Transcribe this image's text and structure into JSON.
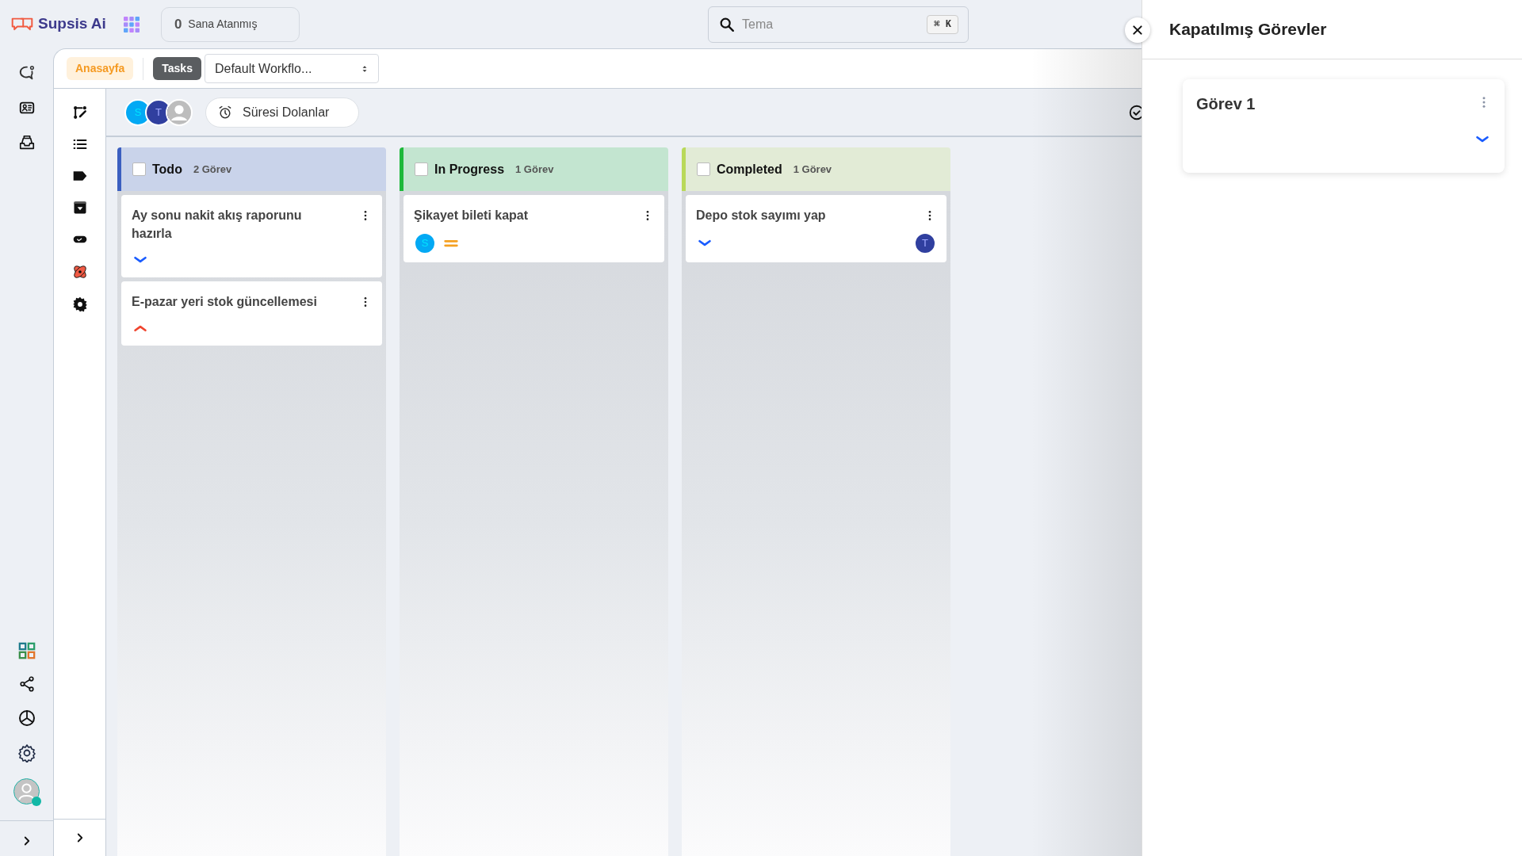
{
  "app": {
    "name": "Supsis Ai"
  },
  "assigned": {
    "count": "0",
    "label": "Sana Atanmış"
  },
  "search": {
    "value": "Tema",
    "shortcut": "⌘ K"
  },
  "breadcrumb": [
    {
      "label": "Anasayfa",
      "kind": "home"
    },
    {
      "label": "Tasks",
      "kind": "current"
    }
  ],
  "workflow_select": {
    "value": "Default Workflo..."
  },
  "filter_avatars": [
    {
      "kind": "initial",
      "text": "S",
      "color": "#03a9f4"
    },
    {
      "kind": "initial",
      "text": "T",
      "color": "#303f9f"
    },
    {
      "kind": "photo"
    }
  ],
  "overdue_button": {
    "label": "Süresi Dolanlar"
  },
  "columns": [
    {
      "title": "Todo",
      "count": "2 Görev",
      "color": "#3b5fc0",
      "checked": false,
      "cards": [
        {
          "title": "Ay sonu nakit akış raporunu hazırla",
          "footer_start": [
            {
              "kind": "priority_low"
            }
          ]
        },
        {
          "title": "E-pazar yeri stok güncellemesi",
          "footer_start": [
            {
              "kind": "priority_high"
            }
          ]
        }
      ]
    },
    {
      "title": "In Progress",
      "count": "1 Görev",
      "color": "#1db83a",
      "checked": false,
      "cards": [
        {
          "title": "Şikayet bileti kapat",
          "footer_start": [
            {
              "kind": "avatar",
              "text": "S",
              "color": "#03a9f4"
            },
            {
              "kind": "priority_medium"
            }
          ]
        }
      ]
    },
    {
      "title": "Completed",
      "count": "1 Görev",
      "color": "#b9d95a",
      "checked": false,
      "cards": [
        {
          "title": "Depo stok sayımı yap",
          "footer_start": [
            {
              "kind": "priority_low"
            }
          ],
          "footer_end": [
            {
              "kind": "avatar",
              "text": "T",
              "color": "#303f9f"
            }
          ]
        }
      ]
    }
  ],
  "drawer": {
    "title": "Kapatılmış Görevler",
    "cards": [
      {
        "title": "Görev 1",
        "footer_end": [
          {
            "kind": "priority_low"
          }
        ]
      }
    ]
  }
}
